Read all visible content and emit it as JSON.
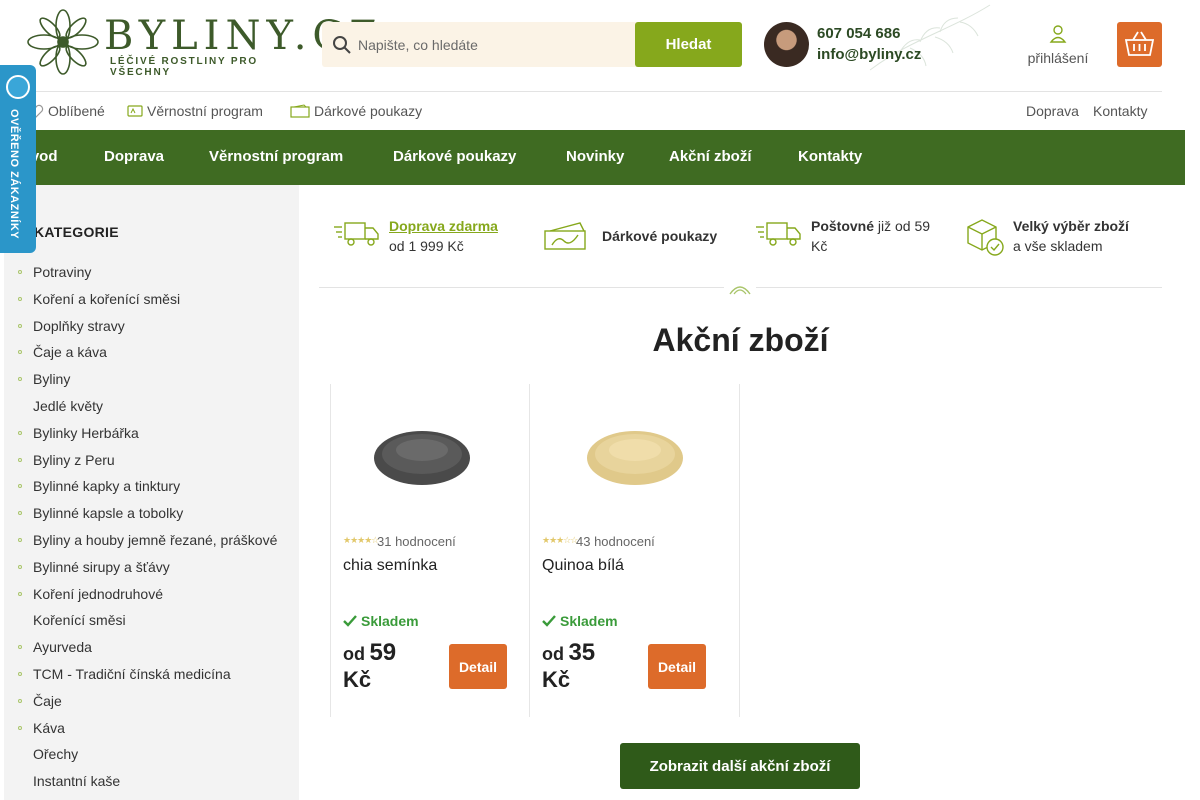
{
  "logo": {
    "name": "BYLINY.CZ",
    "tagline": "LÉČIVÉ ROSTLINY PRO VŠECHNY"
  },
  "search": {
    "placeholder": "Napište, co hledáte",
    "button_label": "Hledat"
  },
  "contact": {
    "phone": "607 054 686",
    "email": "info@byliny.cz"
  },
  "account": {
    "login_label": "přihlášení"
  },
  "sublinks": {
    "left": [
      "Oblíbené",
      "Věrnostní program",
      "Dárkové poukazy"
    ],
    "right": [
      "Doprava",
      "Kontakty"
    ]
  },
  "mainnav": [
    "Úvod",
    "Doprava",
    "Věrnostní program",
    "Dárkové poukazy",
    "Novinky",
    "Akční zboží",
    "Kontakty"
  ],
  "badge": {
    "label": "OVĚŘENO ZÁKAZNÍKY"
  },
  "sidebar": {
    "title": "KATEGORIE",
    "items": [
      "Potraviny",
      "Koření a kořenící směsi",
      "Doplňky stravy",
      "Čaje a káva",
      "Byliny",
      "Jedlé květy",
      "Bylinky Herbářka",
      "Byliny z Peru",
      "Bylinné kapky a tinktury",
      "Bylinné kapsle a tobolky",
      "Byliny a houby jemně řezané, práškové",
      "Bylinné sirupy a šťávy",
      "Koření jednodruhové",
      "Kořenící směsi",
      "Ayurveda",
      "TCM - Tradiční čínská medicína",
      "Čaje",
      "Káva",
      "Ořechy",
      "Instantní kaše"
    ]
  },
  "benefits": [
    {
      "title": "Doprava zdarma",
      "text": "od 1 999 Kč"
    },
    {
      "title": "Dárkové poukazy"
    },
    {
      "title": "Poštovné",
      "text_rest": "již od 59 Kč"
    },
    {
      "title": "Velký výběr zboží",
      "text": "a vše skladem"
    }
  ],
  "section": {
    "title": "Akční zboží"
  },
  "products": [
    {
      "name": "chia semínka",
      "rating_count": "31 hodnocení",
      "stars": "★★★★☆",
      "stock": "Skladem",
      "price_prefix": "od",
      "price": "59",
      "currency": "Kč",
      "detail_label": "Detail",
      "image_color": "#4a4a4a"
    },
    {
      "name": "Quinoa bílá",
      "rating_count": "43 hodnocení",
      "stars": "★★★☆☆",
      "stock": "Skladem",
      "price_prefix": "od",
      "price": "35",
      "currency": "Kč",
      "detail_label": "Detail",
      "image_color": "#e0c98a"
    }
  ],
  "more_button": "Zobrazit další akční zboží",
  "colors": {
    "primary_green": "#3f6b22",
    "accent_green": "#86a81c",
    "orange": "#dd6b2a",
    "dark_green_button": "#2f5a19",
    "badge_blue": "#2b96c9"
  }
}
